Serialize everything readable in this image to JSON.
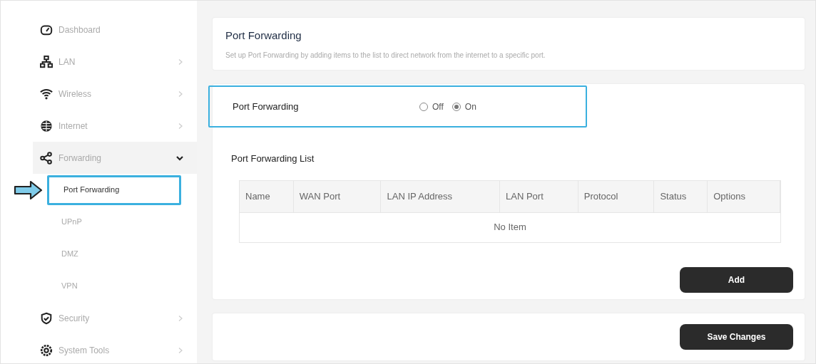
{
  "sidebar": {
    "items": [
      {
        "kind": "link",
        "label": "Dashboard"
      },
      {
        "kind": "group",
        "label": "LAN",
        "expanded": false
      },
      {
        "kind": "group",
        "label": "Wireless",
        "expanded": false
      },
      {
        "kind": "group",
        "label": "Internet",
        "expanded": false
      },
      {
        "kind": "group",
        "label": "Forwarding",
        "expanded": true,
        "children": [
          {
            "label": "Port Forwarding",
            "selected": true
          },
          {
            "label": "UPnP",
            "selected": false
          },
          {
            "label": "DMZ",
            "selected": false
          },
          {
            "label": "VPN",
            "selected": false
          }
        ]
      },
      {
        "kind": "group",
        "label": "Security",
        "expanded": false
      },
      {
        "kind": "group",
        "label": "System Tools",
        "expanded": false
      }
    ]
  },
  "header": {
    "title": "Port Forwarding",
    "description": "Set up Port Forwarding by adding items to the list to direct network from the internet to a specific port."
  },
  "toggle": {
    "label": "Port Forwarding",
    "options": [
      {
        "label": "Off",
        "selected": false
      },
      {
        "label": "On",
        "selected": true
      }
    ]
  },
  "list": {
    "title": "Port Forwarding List",
    "columns": [
      "Name",
      "WAN Port",
      "LAN IP Address",
      "LAN Port",
      "Protocol",
      "Status",
      "Options"
    ],
    "empty_text": "No Item"
  },
  "buttons": {
    "add": "Add",
    "save": "Save Changes"
  }
}
